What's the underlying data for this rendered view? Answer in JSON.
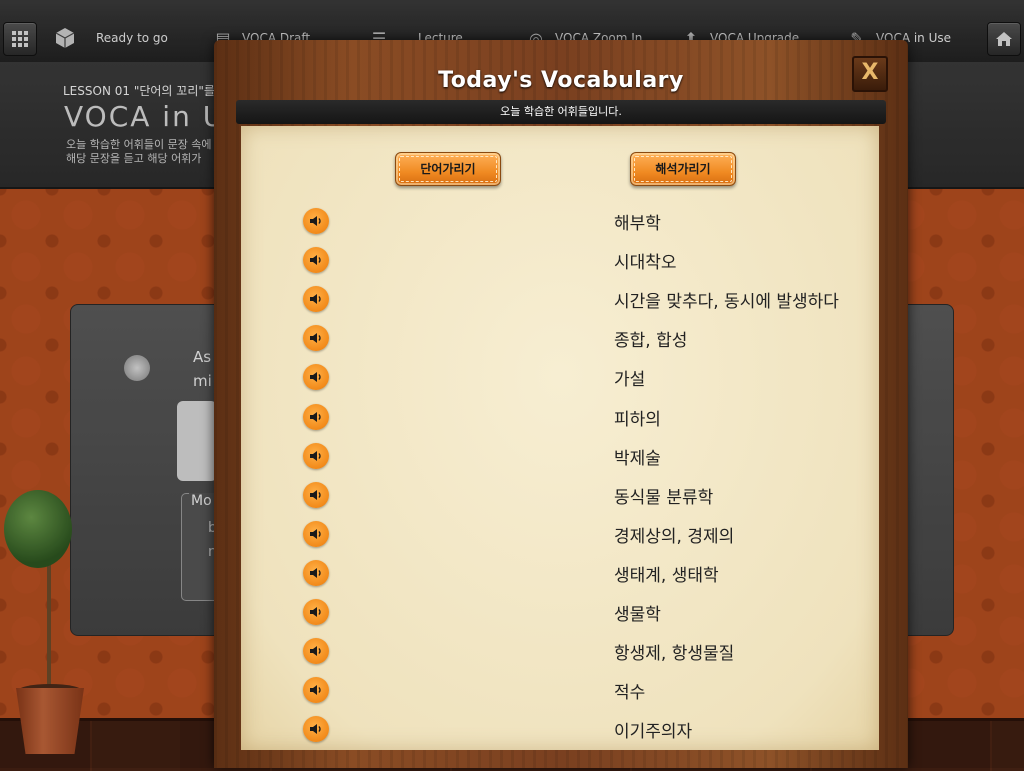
{
  "toolbar": {
    "items": [
      {
        "label": "Ready to go",
        "icon": "cube-icon"
      },
      {
        "label": "VOCA Draft",
        "icon": "document-icon"
      },
      {
        "label": "Lecture",
        "icon": "list-icon"
      },
      {
        "label": "VOCA Zoom In",
        "icon": "zoom-icon"
      },
      {
        "label": "VOCA Upgrade",
        "icon": "upgrade-icon"
      },
      {
        "label": "VOCA in Use",
        "icon": "pencil-icon"
      }
    ],
    "grid_icon": "grid-icon",
    "home_icon": "home-icon"
  },
  "lesson": {
    "label": "LESSON 01 \"단어의 꼬리\"를 ",
    "title": "VOCA in Us",
    "desc_line1": "오늘 학습한 어휘들이 문장 속에",
    "desc_line2": "해당 문장을 듣고 해당 어휘가"
  },
  "exercise": {
    "text_line1": "As",
    "text_line2": "mi",
    "more_label": "Mo",
    "more_text_line1": "b",
    "more_text_line2": "n"
  },
  "modal": {
    "title": "Today's Vocabulary",
    "close_label": "X",
    "subtitle": "오늘 학습한 어휘들입니다.",
    "hide_words_label": "단어가리기",
    "hide_meanings_label": "해석가리기",
    "meanings": [
      "해부학",
      "시대착오",
      "시간을 맞추다, 동시에 발생하다",
      "종합, 합성",
      "가설",
      "피하의",
      "박제술",
      "동식물 분류학",
      "경제상의, 경제의",
      "생태계, 생태학",
      "생물학",
      "항생제, 항생물질",
      "적수",
      "이기주의자"
    ]
  },
  "colors": {
    "accent_orange": "#f28a1a",
    "wood": "#7a4020",
    "paper": "#f3e7c6",
    "wallpaper": "#b44e1f"
  }
}
